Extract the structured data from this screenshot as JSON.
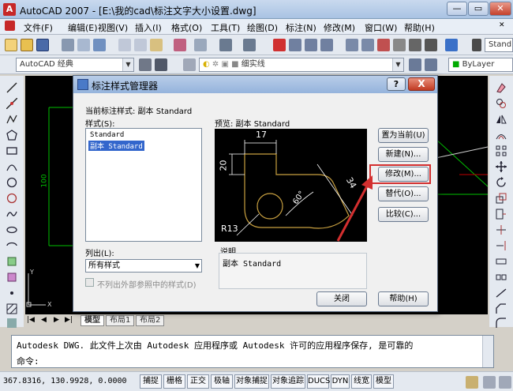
{
  "app": {
    "icon_text": "A",
    "title": "AutoCAD 2007 - [E:\\我的cad\\标注文字大小设置.dwg]"
  },
  "menubar": {
    "items": [
      "文件(F)",
      "编辑(E)",
      "视图(V)",
      "插入(I)",
      "格式(O)",
      "工具(T)",
      "绘图(D)",
      "标注(N)",
      "修改(M)",
      "窗口(W)",
      "帮助(H)"
    ]
  },
  "toolbar2": {
    "workspace": "AutoCAD 经典",
    "linetype": "细实线",
    "bylayer": "ByLayer"
  },
  "toolbar1": {
    "style_combo": "Stand"
  },
  "drawing": {
    "left_dimension": "100",
    "ucs_y": "Y",
    "ucs_x": "X"
  },
  "tabs": [
    "模型",
    "布局1",
    "布局2"
  ],
  "command": {
    "line1": "Autodesk DWG.  此文件上次由 Autodesk 应用程序或 Autodesk 许可的应用程序保存, 是可靠的",
    "line2": "命令:"
  },
  "statusbar": {
    "coords": "367.8316, 130.9928, 0.0000",
    "buttons": [
      "捕捉",
      "栅格",
      "正交",
      "极轴",
      "对象捕捉",
      "对象追踪",
      "DUCS",
      "DYN",
      "线宽",
      "模型"
    ]
  },
  "dialog": {
    "title": "标注样式管理器",
    "help_btn": "?",
    "close_btn": "X",
    "current_style_label": "当前标注样式: 副本 Standard",
    "styles_label": "样式(S):",
    "styles": [
      "Standard",
      "副本 Standard"
    ],
    "selected_style_index": 1,
    "preview_label": "预览: 副本 Standard",
    "list_label": "列出(L):",
    "list_value": "所有样式",
    "xref_label": "不列出外部参照中的样式(D)",
    "xref_checked": false,
    "desc_label": "说明",
    "desc_value": "副本 Standard",
    "buttons": {
      "set_current": "置为当前(U)",
      "new": "新建(N)...",
      "modify": "修改(M)...",
      "override": "替代(O)...",
      "compare": "比较(C)...",
      "close": "关闭",
      "help": "帮助(H)"
    },
    "preview_dims": {
      "top": "17",
      "left": "20",
      "diag": "34",
      "angle": "60°",
      "radius": "R13"
    }
  },
  "colors": {
    "highlight": "#d32f2f",
    "drawing_bg": "#000000",
    "dim_green": "#00c000"
  }
}
